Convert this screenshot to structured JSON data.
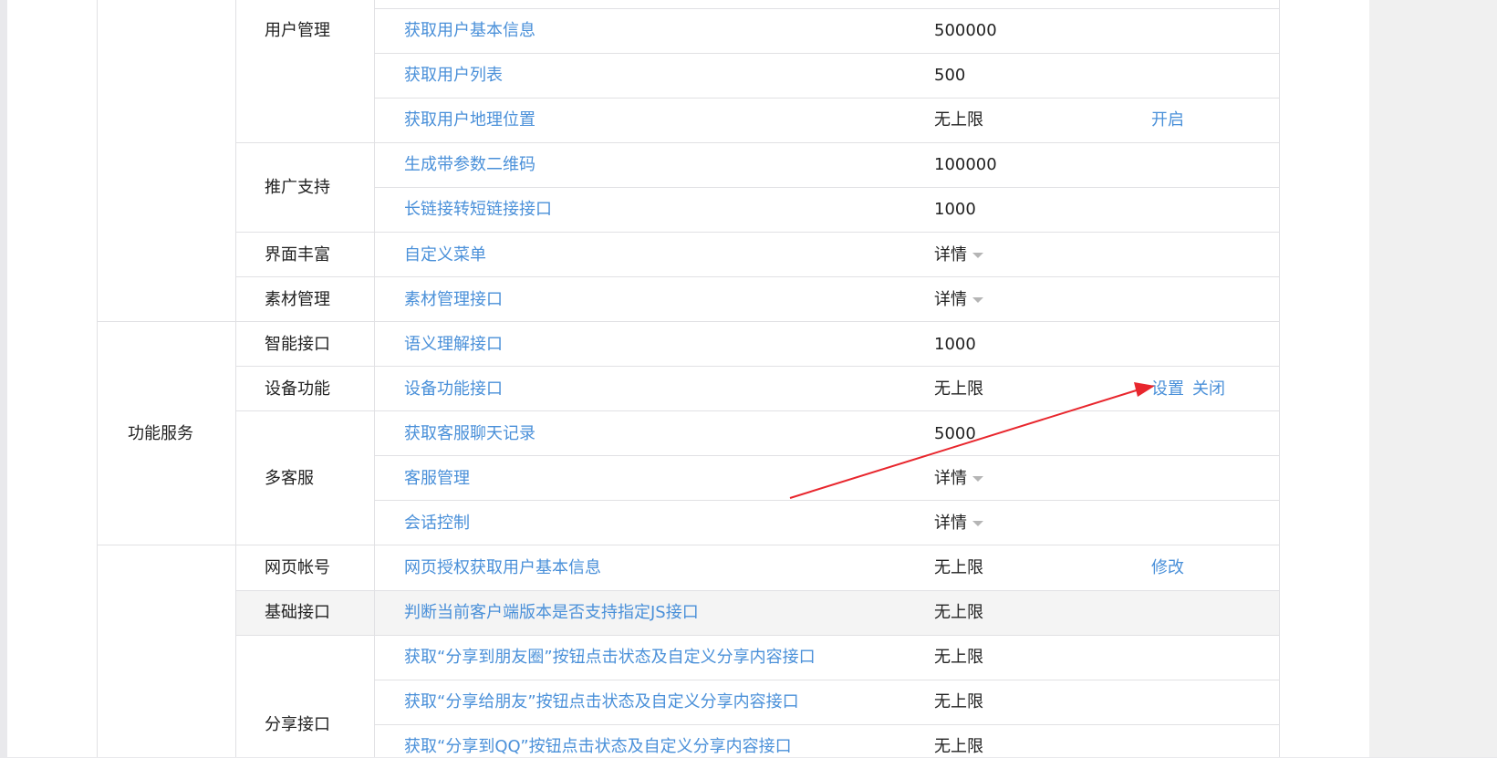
{
  "groups": {
    "func_service": "功能服务"
  },
  "categories": {
    "user_mgmt": "用户管理",
    "promo": "推广支持",
    "ui_rich": "界面丰富",
    "material": "素材管理",
    "smart": "智能接口",
    "device": "设备功能",
    "multi_cs": "多客服",
    "web_account": "网页帐号",
    "basic": "基础接口",
    "share": "分享接口"
  },
  "rows": [
    {
      "api": "获取用户基本信息",
      "quota": "500000",
      "action": ""
    },
    {
      "api": "获取用户列表",
      "quota": "500",
      "action": ""
    },
    {
      "api": "获取用户地理位置",
      "quota": "无上限",
      "action": "开启"
    },
    {
      "api": "生成带参数二维码",
      "quota": "100000",
      "action": ""
    },
    {
      "api": "长链接转短链接接口",
      "quota": "1000",
      "action": ""
    },
    {
      "api": "自定义菜单",
      "quota": "详情",
      "action": ""
    },
    {
      "api": "素材管理接口",
      "quota": "详情",
      "action": ""
    },
    {
      "api": "语义理解接口",
      "quota": "1000",
      "action": ""
    },
    {
      "api": "设备功能接口",
      "quota": "无上限",
      "action": "设置",
      "action2": "关闭"
    },
    {
      "api": "获取客服聊天记录",
      "quota": "5000",
      "action": ""
    },
    {
      "api": "客服管理",
      "quota": "详情",
      "action": ""
    },
    {
      "api": "会话控制",
      "quota": "详情",
      "action": ""
    },
    {
      "api": "网页授权获取用户基本信息",
      "quota": "无上限",
      "action": "修改"
    },
    {
      "api": "判断当前客户端版本是否支持指定JS接口",
      "quota": "无上限",
      "action": ""
    },
    {
      "api": "获取“分享到朋友圈”按钮点击状态及自定义分享内容接口",
      "quota": "无上限",
      "action": ""
    },
    {
      "api": "获取“分享给朋友”按钮点击状态及自定义分享内容接口",
      "quota": "无上限",
      "action": ""
    },
    {
      "api": "获取“分享到QQ”按钮点击状态及自定义分享内容接口",
      "quota": "无上限",
      "action": ""
    }
  ],
  "colors": {
    "link": "#4a90d9",
    "text": "#222222",
    "border": "#e1e1e4",
    "annotation_arrow": "#e8262d"
  },
  "icons": {
    "detail_caret": "caret-down-icon"
  }
}
